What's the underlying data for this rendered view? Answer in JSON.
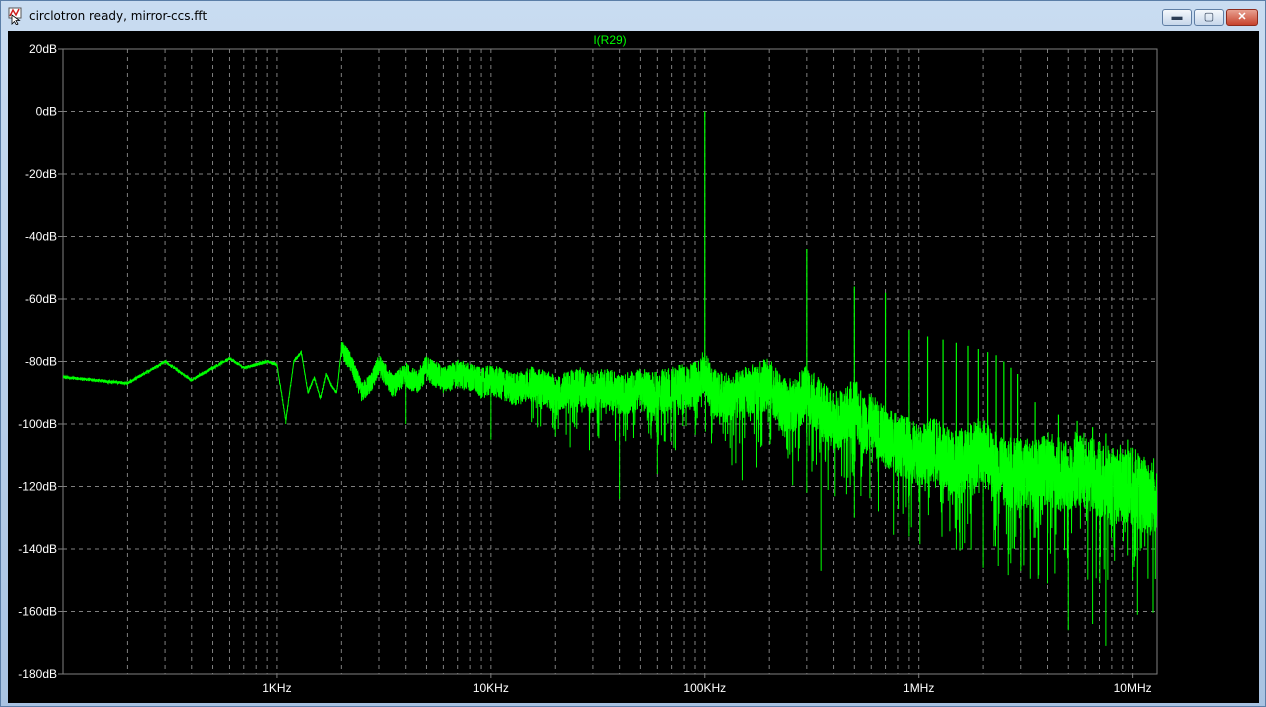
{
  "window": {
    "title": "circlotron ready, mirror-ccs.fft",
    "buttons": {
      "minimize": "▬",
      "maximize": "▢",
      "close": "✕"
    }
  },
  "chart_data": {
    "type": "line",
    "title": "I(R29)",
    "x_scale": "log",
    "xlim": [
      100,
      13000000
    ],
    "ylim": [
      -180,
      20
    ],
    "y_ticks": [
      20,
      0,
      -20,
      -40,
      -60,
      -80,
      -100,
      -120,
      -140,
      -160,
      -180
    ],
    "y_tick_labels": [
      "20dB",
      "0dB",
      "-20dB",
      "-40dB",
      "-60dB",
      "-80dB",
      "-100dB",
      "-120dB",
      "-140dB",
      "-160dB",
      "-180dB"
    ],
    "x_ticks": [
      1000,
      10000,
      100000,
      1000000,
      10000000
    ],
    "x_tick_labels": [
      "1KHz",
      "10KHz",
      "100KHz",
      "1MHz",
      "10MHz"
    ],
    "grid": true,
    "colors": {
      "background": "#000000",
      "trace": "#00ff00",
      "grid": "#7f7f7f",
      "axis": "#7f7f7f",
      "text": "#ffffff",
      "title": "#00ff00"
    },
    "series": [
      {
        "name": "I(R29)",
        "x": [
          100,
          200,
          300,
          400,
          500,
          600,
          700,
          800,
          900,
          1000,
          1100,
          1200,
          1300,
          1400,
          1500,
          1600,
          1700,
          1800,
          1900,
          2000,
          2200,
          2500,
          2800,
          3000,
          3500,
          4000,
          4500,
          5000,
          6000,
          7000,
          8000,
          9000,
          10000,
          11000,
          12000,
          13000,
          15000,
          17000,
          20000,
          23000,
          26000,
          30000,
          35000,
          40000,
          50000,
          60000,
          70000,
          80000,
          90000,
          100000,
          110000,
          120000,
          130000,
          150000,
          170000,
          200000,
          230000,
          260000,
          300000,
          350000,
          400000,
          450000,
          500000,
          550000,
          600000,
          700000,
          800000,
          900000,
          1000000,
          1200000,
          1400000,
          1600000,
          1800000,
          2000000,
          2200000,
          2500000,
          3000000,
          3500000,
          4000000,
          4500000,
          5000000,
          5500000,
          6000000,
          7000000,
          8000000,
          9000000,
          10000000,
          11000000,
          12000000,
          13000000
        ],
        "y": [
          -85,
          -87,
          -80,
          -86,
          -82,
          -79,
          -82,
          -81,
          -80,
          -81,
          -99,
          -80,
          -77,
          -90,
          -85,
          -92,
          -84,
          -88,
          -90,
          -76,
          -80,
          -90,
          -86,
          -81,
          -88,
          -84,
          -87,
          -82,
          -86,
          -84,
          -85,
          -87,
          -86,
          -87,
          -88,
          -89,
          -87,
          -88,
          -90,
          -89,
          -88,
          -90,
          -88,
          -91,
          -89,
          -90,
          -89,
          -88,
          -87,
          -84,
          -90,
          -91,
          -92,
          -90,
          -89,
          -87,
          -94,
          -94,
          -90,
          -95,
          -99,
          -98,
          -94,
          -100,
          -100,
          -104,
          -106,
          -108,
          -110,
          -108,
          -112,
          -112,
          -110,
          -108,
          -113,
          -115,
          -116,
          -116,
          -114,
          -116,
          -116,
          -114,
          -115,
          -118,
          -120,
          -119,
          -120,
          -122,
          -124,
          -122
        ]
      }
    ],
    "spikes": [
      {
        "x": 100000,
        "y": 0
      },
      {
        "x": 300000,
        "y": -44
      },
      {
        "x": 500000,
        "y": -56
      },
      {
        "x": 700000,
        "y": -58
      },
      {
        "x": 900000,
        "y": -70
      },
      {
        "x": 1100000,
        "y": -72
      },
      {
        "x": 1300000,
        "y": -73
      },
      {
        "x": 1500000,
        "y": -74
      },
      {
        "x": 1700000,
        "y": -75
      },
      {
        "x": 1900000,
        "y": -76
      },
      {
        "x": 2100000,
        "y": -77
      },
      {
        "x": 2300000,
        "y": -78
      },
      {
        "x": 2500000,
        "y": -80
      },
      {
        "x": 2700000,
        "y": -82
      },
      {
        "x": 2900000,
        "y": -84
      },
      {
        "x": 3500000,
        "y": -93
      },
      {
        "x": 4500000,
        "y": -97
      },
      {
        "x": 5500000,
        "y": -99
      },
      {
        "x": 6500000,
        "y": -101
      },
      {
        "x": 7500000,
        "y": -103
      },
      {
        "x": 9500000,
        "y": -105
      }
    ],
    "dips": [
      {
        "x": 1100,
        "y": -100
      },
      {
        "x": 4000,
        "y": -100
      },
      {
        "x": 10000,
        "y": -105
      },
      {
        "x": 20000,
        "y": -104
      },
      {
        "x": 40000,
        "y": -124
      },
      {
        "x": 60000,
        "y": -116
      },
      {
        "x": 150000,
        "y": -118
      },
      {
        "x": 300000,
        "y": -122
      },
      {
        "x": 350000,
        "y": -147
      },
      {
        "x": 500000,
        "y": -130
      },
      {
        "x": 900000,
        "y": -136
      },
      {
        "x": 1600000,
        "y": -140
      },
      {
        "x": 2000000,
        "y": -146
      },
      {
        "x": 3000000,
        "y": -147
      },
      {
        "x": 4000000,
        "y": -151
      },
      {
        "x": 5000000,
        "y": -166
      },
      {
        "x": 6500000,
        "y": -164
      },
      {
        "x": 7500000,
        "y": -171
      },
      {
        "x": 10000000,
        "y": -150
      }
    ]
  }
}
